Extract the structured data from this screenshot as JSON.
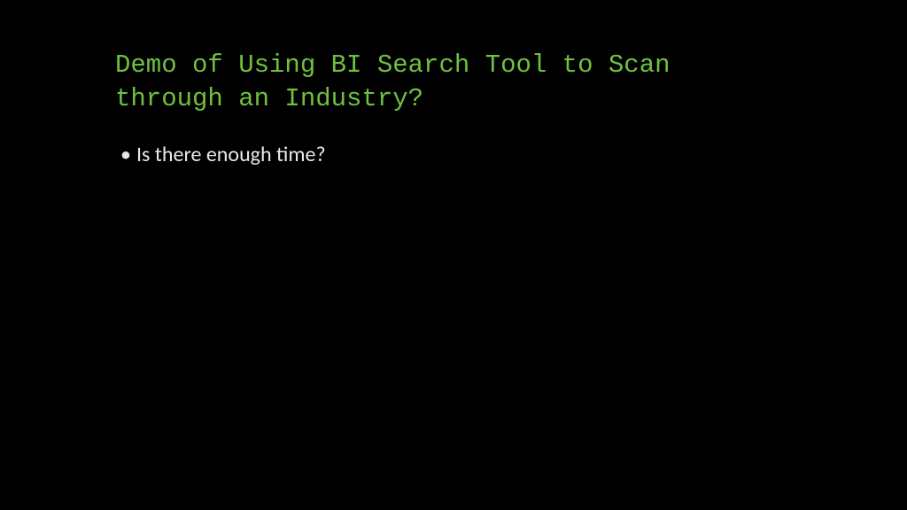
{
  "slide": {
    "title": "Demo of Using BI Search Tool to Scan through an Industry?",
    "bullets": [
      "Is there enough time?"
    ]
  }
}
